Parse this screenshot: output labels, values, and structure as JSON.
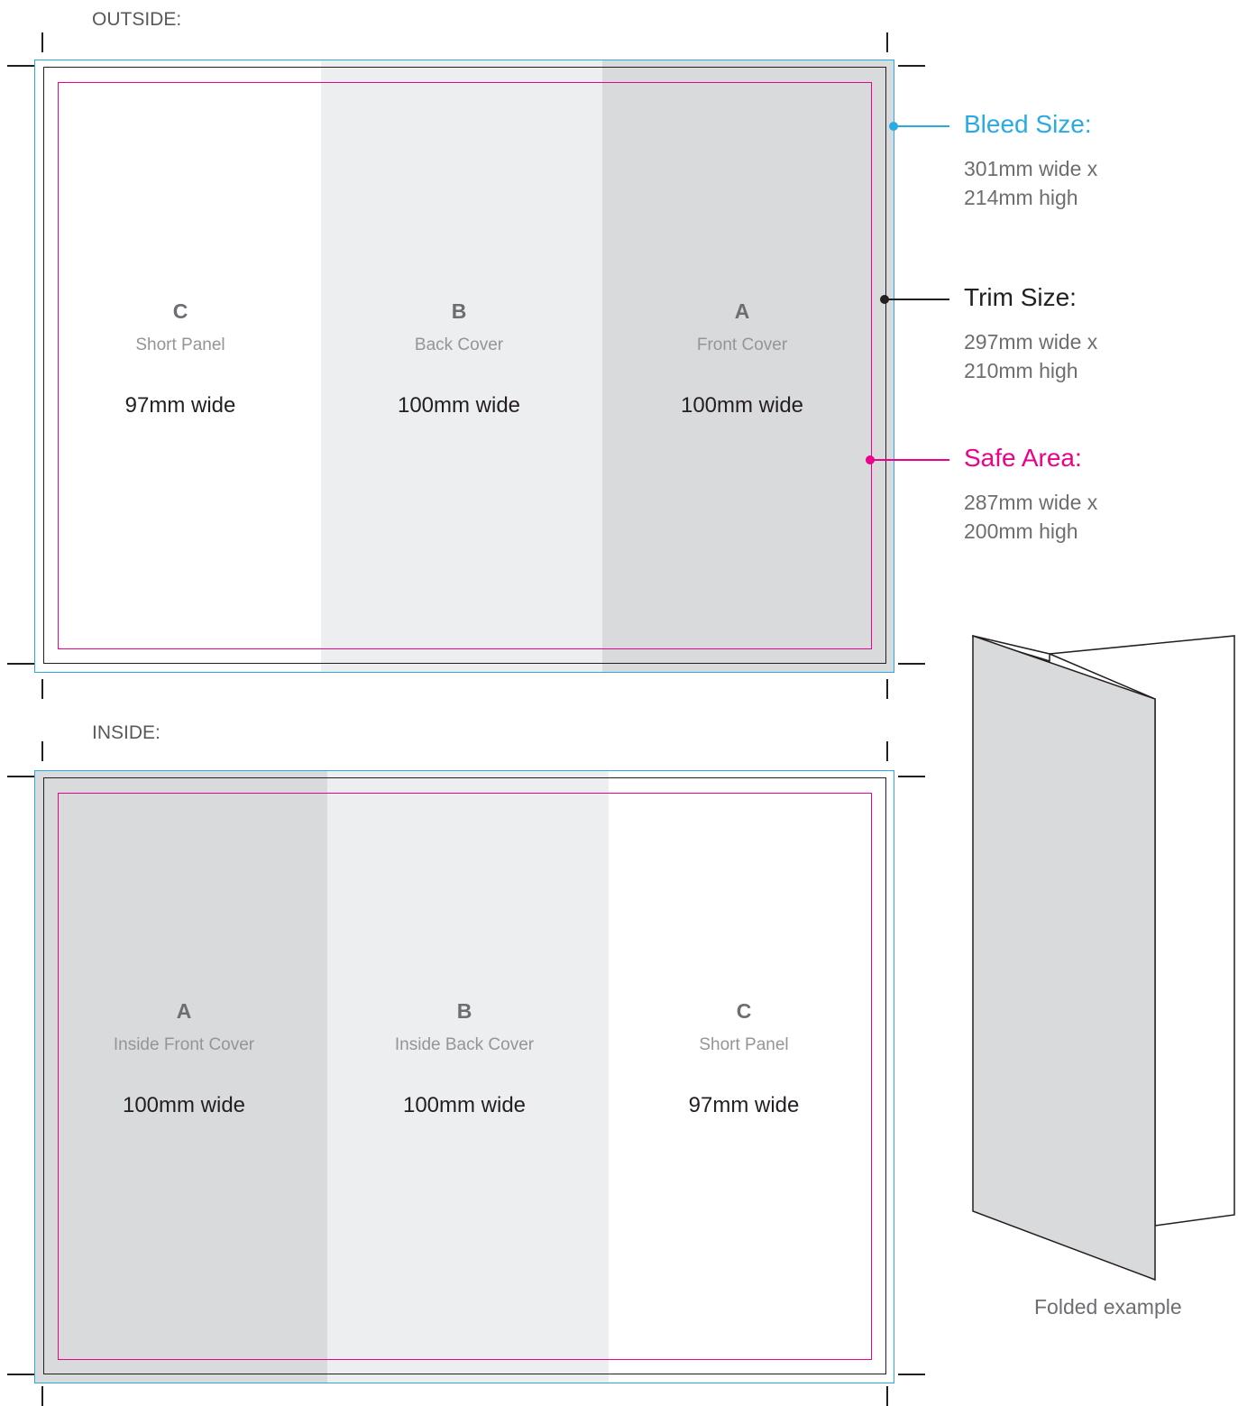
{
  "outside": {
    "label": "OUTSIDE:",
    "panels": [
      {
        "letter": "C",
        "name": "Short Panel",
        "width": "97mm wide"
      },
      {
        "letter": "B",
        "name": "Back Cover",
        "width": "100mm wide"
      },
      {
        "letter": "A",
        "name": "Front Cover",
        "width": "100mm wide"
      }
    ]
  },
  "inside": {
    "label": "INSIDE:",
    "panels": [
      {
        "letter": "A",
        "name": "Inside Front Cover",
        "width": "100mm wide"
      },
      {
        "letter": "B",
        "name": "Inside Back Cover",
        "width": "100mm wide"
      },
      {
        "letter": "C",
        "name": "Short Panel",
        "width": "97mm wide"
      }
    ]
  },
  "legend": {
    "bleed": {
      "title": "Bleed Size:",
      "desc": "301mm wide x\n214mm high",
      "color": "#29abe2"
    },
    "trim": {
      "title": "Trim Size:",
      "desc": "297mm wide x\n210mm high",
      "color": "#231f20"
    },
    "safe": {
      "title": "Safe Area:",
      "desc": "287mm wide x\n200mm high",
      "color": "#ec008c"
    }
  },
  "folded": {
    "caption": "Folded example"
  }
}
